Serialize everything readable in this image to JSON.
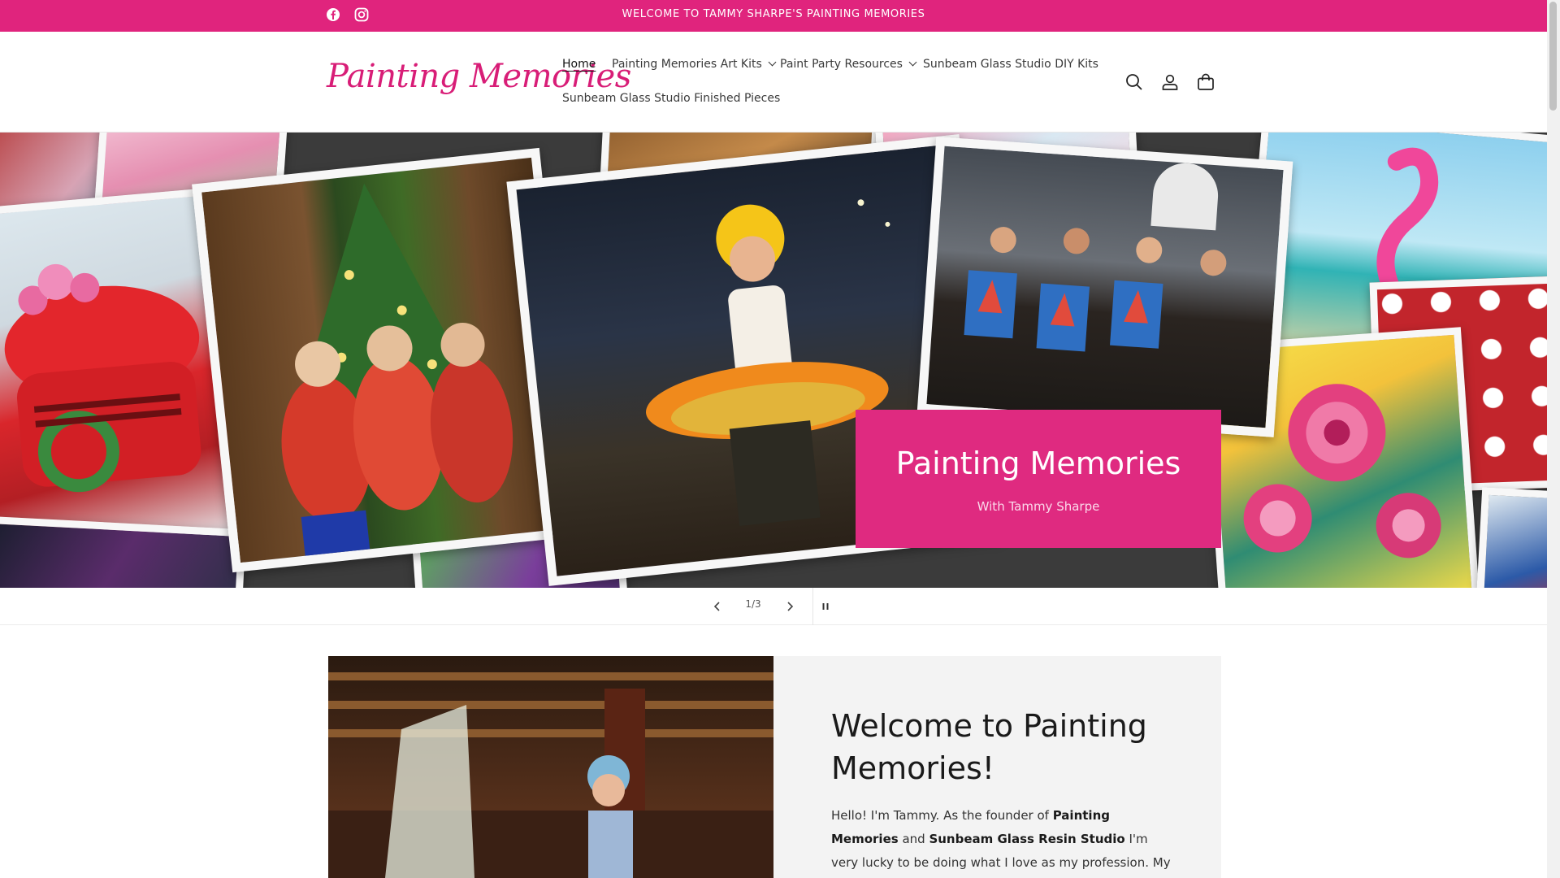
{
  "announcement": {
    "text": "WELCOME TO TAMMY SHARPE'S PAINTING MEMORIES",
    "social": [
      {
        "icon": "facebook-icon"
      },
      {
        "icon": "instagram-icon"
      }
    ]
  },
  "header": {
    "logo": "Painting Memories",
    "nav": [
      {
        "label": "Home",
        "active": true,
        "dropdown": false
      },
      {
        "label": "Painting Memories Art Kits",
        "active": false,
        "dropdown": true
      },
      {
        "label": "Paint Party Resources",
        "active": false,
        "dropdown": true
      },
      {
        "label": "Sunbeam Glass Studio DIY Kits",
        "active": false,
        "dropdown": false
      },
      {
        "label": "Sunbeam Glass Studio Finished Pieces",
        "active": false,
        "dropdown": false
      }
    ],
    "icons": [
      "search-icon",
      "account-icon",
      "cart-icon"
    ]
  },
  "hero": {
    "title": "Painting Memories",
    "subtitle": "With Tammy Sharpe"
  },
  "slider": {
    "counter": "1/3",
    "current": 1,
    "total": 3
  },
  "welcome": {
    "title": "Welcome to Painting Memories!",
    "text_1": "Hello! I'm Tammy. As the founder of ",
    "bold_1": "Painting Memories",
    "text_2": " and ",
    "bold_2": "Sunbeam Glass Resin Studio",
    "text_3": " I'm very lucky to be doing what I love as my profession. My Art Parties have"
  },
  "colors": {
    "brand_pink": "#e0247d",
    "panel_bg": "#f3f3f3"
  }
}
